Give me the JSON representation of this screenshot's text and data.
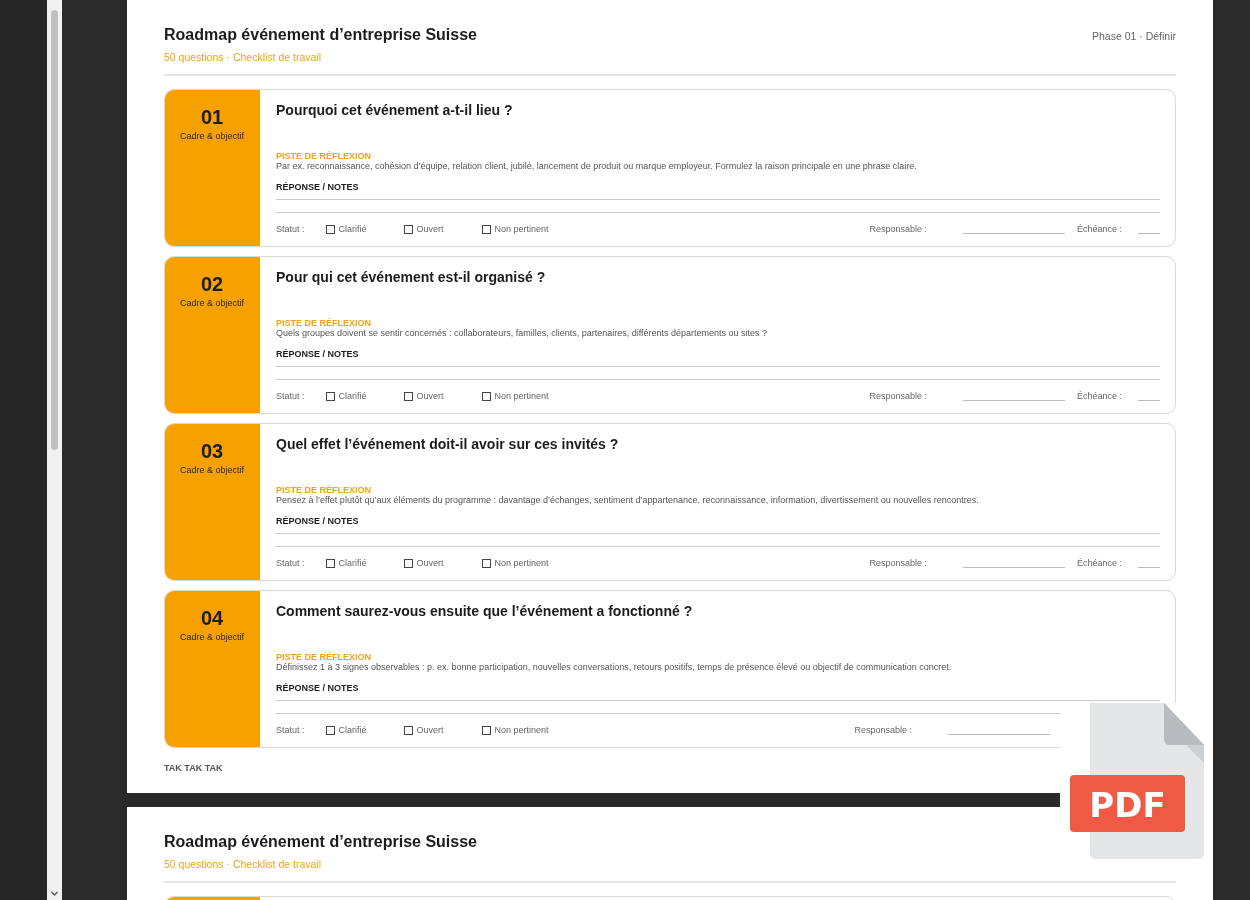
{
  "pages": [
    {
      "title": "Roadmap événement d’entreprise Suisse",
      "subtitle": "50 questions · Checklist de travail",
      "phase": "Phase 01 · Définir",
      "footer": "TAK TAK TAK",
      "cards": [
        {
          "number": "01",
          "category": "Cadre & objectif",
          "question": "Pourquoi cet événement a-t-il lieu ?",
          "hint_label": "PISTE DE RÉFLEXION",
          "hint": "Par ex. reconnaissance, cohésion d’équipe, relation client, jubilé, lancement de produit ou marque employeur. Formulez la raison principale en une phrase claire.",
          "answer_label": "RÉPONSE / NOTES",
          "status_label": "Statut :",
          "options": [
            {
              "label": "Clarifié",
              "checked": false
            },
            {
              "label": "Ouvert",
              "checked": false
            },
            {
              "label": "Non pertinent",
              "checked": false
            }
          ],
          "owner_label": "Responsable :",
          "due_label": "Échéance :"
        },
        {
          "number": "02",
          "category": "Cadre & objectif",
          "question": "Pour qui cet événement est-il organisé ?",
          "hint_label": "PISTE DE RÉFLEXION",
          "hint": "Quels groupes doivent se sentir concernés : collaborateurs, familles, clients, partenaires, différents départements ou sites ?",
          "answer_label": "RÉPONSE / NOTES",
          "status_label": "Statut :",
          "options": [
            {
              "label": "Clarifié",
              "checked": false
            },
            {
              "label": "Ouvert",
              "checked": false
            },
            {
              "label": "Non pertinent",
              "checked": false
            }
          ],
          "owner_label": "Responsable :",
          "due_label": "Échéance :"
        },
        {
          "number": "03",
          "category": "Cadre & objectif",
          "question": "Quel effet l’événement doit-il avoir sur ces invités ?",
          "hint_label": "PISTE DE RÉFLEXION",
          "hint": "Pensez à l’effet plutôt qu’aux éléments du programme : davantage d’échanges, sentiment d’appartenance, reconnaissance, information, divertissement ou nouvelles rencontres.",
          "answer_label": "RÉPONSE / NOTES",
          "status_label": "Statut :",
          "options": [
            {
              "label": "Clarifié",
              "checked": false
            },
            {
              "label": "Ouvert",
              "checked": false
            },
            {
              "label": "Non pertinent",
              "checked": false
            }
          ],
          "owner_label": "Responsable :",
          "due_label": "Échéance :"
        },
        {
          "number": "04",
          "category": "Cadre & objectif",
          "question": "Comment saurez-vous ensuite que l’événement a fonctionné ?",
          "hint_label": "PISTE DE RÉFLEXION",
          "hint": "Définissez 1 à 3 signes observables : p. ex. bonne participation, nouvelles conversations, retours positifs, temps de présence élevé ou objectif de communication concret.",
          "answer_label": "RÉPONSE / NOTES",
          "status_label": "Statut :",
          "options": [
            {
              "label": "Clarifié",
              "checked": false
            },
            {
              "label": "Ouvert",
              "checked": false
            },
            {
              "label": "Non pertinent",
              "checked": false
            }
          ],
          "owner_label": "Responsable :"
        }
      ]
    },
    {
      "title": "Roadmap événement d’entreprise Suisse",
      "subtitle": "50 questions · Checklist de travail"
    }
  ],
  "file_badge": {
    "label": "PDF"
  }
}
